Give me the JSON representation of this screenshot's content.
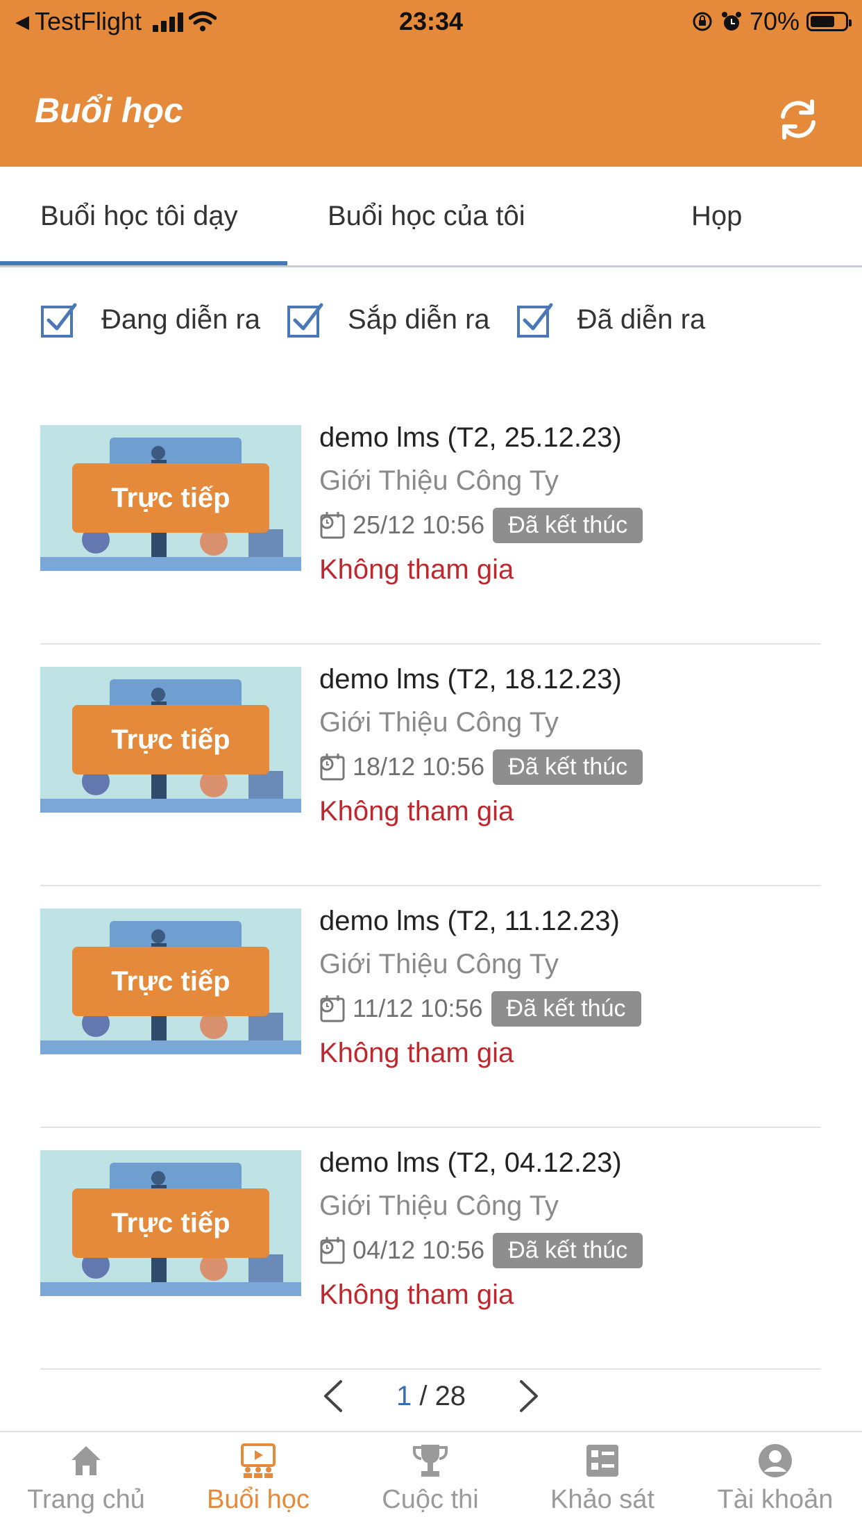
{
  "status_bar": {
    "back_app": "TestFlight",
    "time": "23:34",
    "battery": "70%",
    "battery_level": 0.7
  },
  "header": {
    "title": "Buổi học",
    "refresh_icon": "refresh-icon"
  },
  "tabs": [
    {
      "label": "Buổi học tôi dạy",
      "active": true
    },
    {
      "label": "Buổi học của tôi",
      "active": false
    },
    {
      "label": "Họp",
      "active": false
    }
  ],
  "filters": [
    {
      "label": "Đang diễn ra",
      "checked": true
    },
    {
      "label": "Sắp diễn ra",
      "checked": true
    },
    {
      "label": "Đã diễn ra",
      "checked": true
    }
  ],
  "sessions": [
    {
      "title": "demo lms (T2, 25.12.23)",
      "course": "Giới Thiệu Công Ty",
      "time": "25/12 10:56",
      "status": "Đã kết thúc",
      "attendance": "Không tham gia",
      "thumb_label": "Trực tiếp"
    },
    {
      "title": "demo lms (T2, 18.12.23)",
      "course": "Giới Thiệu Công Ty",
      "time": "18/12 10:56",
      "status": "Đã kết thúc",
      "attendance": "Không tham gia",
      "thumb_label": "Trực tiếp"
    },
    {
      "title": "demo lms (T2, 11.12.23)",
      "course": "Giới Thiệu Công Ty",
      "time": "11/12 10:56",
      "status": "Đã kết thúc",
      "attendance": "Không tham gia",
      "thumb_label": "Trực tiếp"
    },
    {
      "title": "demo lms (T2, 04.12.23)",
      "course": "Giới Thiệu Công Ty",
      "time": "04/12 10:56",
      "status": "Đã kết thúc",
      "attendance": "Không tham gia",
      "thumb_label": "Trực tiếp"
    }
  ],
  "pager": {
    "current": "1",
    "separator": "/",
    "total": "28"
  },
  "bottom_nav": [
    {
      "label": "Trang chủ",
      "icon": "home-icon",
      "active": false
    },
    {
      "label": "Buổi học",
      "icon": "classroom-icon",
      "active": true
    },
    {
      "label": "Cuộc thi",
      "icon": "trophy-icon",
      "active": false
    },
    {
      "label": "Khảo sát",
      "icon": "survey-icon",
      "active": false
    },
    {
      "label": "Tài khoản",
      "icon": "account-icon",
      "active": false
    }
  ],
  "colors": {
    "brand": "#e48a3a",
    "tab_indicator": "#4a78b6",
    "attendance": "#c0272d",
    "badge": "#8e8e8e"
  }
}
